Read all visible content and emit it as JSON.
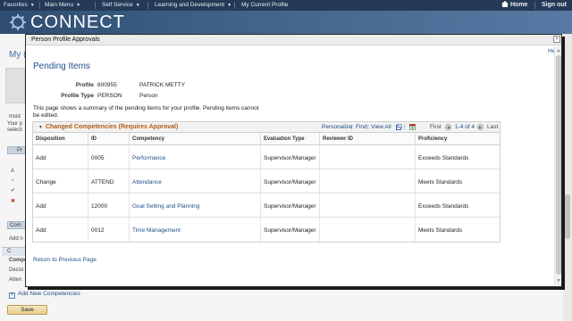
{
  "topnav": {
    "favorites": "Favorites",
    "main_menu": "Main Menu",
    "self_service": "Self Service",
    "learning": "Learning and Development",
    "my_profile": "My Current Profile",
    "home": "Home",
    "sign_out": "Sign out"
  },
  "banner": {
    "logo_text": "CONNECT"
  },
  "background": {
    "title_fragment": "My (",
    "insights_fragment": "Insid",
    "your_fragment_1": "Your p",
    "your_fragment_2": "selecti",
    "pr_fragment": "Pr",
    "a_fragment": "A",
    "com_fragment": "Com",
    "add_fragment": "Add n",
    "c_fragment": "C",
    "comp_fragment": "Compe",
    "decis_fragment": "Decisi",
    "atten_fragment": "Atten",
    "add_new_label": "Add New Competencies",
    "save_label": "Save"
  },
  "modal": {
    "title": "Person Profile Approvals",
    "close": "×",
    "help": "Help",
    "page_title": "Pending Items",
    "profile_label": "Profile",
    "profile_id": "600955",
    "profile_name": "PATRICK METTY",
    "profile_type_label": "Profile Type",
    "profile_type_code": "PERSON",
    "profile_type_desc": "Person",
    "summary": "This page shows a summary of the pending items for your profile. Pending items cannot be edited.",
    "return_link": "Return to Previous Page"
  },
  "grid": {
    "title": "Changed Competencies (Requires Approval)",
    "personalize": "Personalize",
    "find": "Find",
    "view_all": "View All",
    "first": "First",
    "range": "1-4 of 4",
    "last": "Last",
    "sep": "|",
    "columns": [
      "Disposition",
      "ID",
      "Competency",
      "Evaluation Type",
      "Reviewer ID",
      "Proficiency"
    ],
    "rows": [
      {
        "disposition": "Add",
        "id": "0005",
        "competency": "Performance",
        "eval_type": "Supervisor/Manager",
        "reviewer": "",
        "proficiency": "Exceeds Standards"
      },
      {
        "disposition": "Change",
        "id": "ATTEND",
        "competency": "Attendance",
        "eval_type": "Supervisor/Manager",
        "reviewer": "",
        "proficiency": "Meets Standards"
      },
      {
        "disposition": "Add",
        "id": "12000",
        "competency": "Goal Setting and Planning",
        "eval_type": "Supervisor/Manager",
        "reviewer": "",
        "proficiency": "Exceeds Standards"
      },
      {
        "disposition": "Add",
        "id": "0012",
        "competency": "Time Management",
        "eval_type": "Supervisor/Manager",
        "reviewer": "",
        "proficiency": "Meets Standards"
      }
    ]
  },
  "colors": {
    "nav_bg": "#243a56",
    "banner": "#3e6289",
    "link": "#1f4e8c",
    "grid_title": "#b35c12",
    "save_button": "#e7cc8c"
  }
}
